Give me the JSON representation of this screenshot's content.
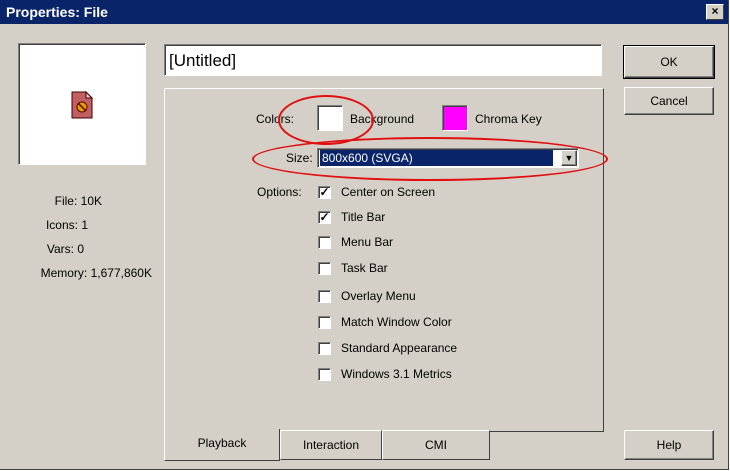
{
  "window": {
    "title": "Properties: File",
    "close_label": "×"
  },
  "left": {
    "file": "File: 10K",
    "icons": "Icons: 1",
    "vars": "Vars: 0",
    "memory": "Memory: 1,677,860K"
  },
  "name_field": {
    "value": "[Untitled]"
  },
  "colors": {
    "label": "Colors:",
    "background_label": "Background",
    "chroma_label": "Chroma Key",
    "background_color": "#ffffff",
    "chroma_color": "#ff00ff"
  },
  "size": {
    "label": "Size:",
    "value": "800x600 (SVGA)"
  },
  "options": {
    "label": "Options:",
    "items": [
      {
        "label": "Center on Screen",
        "checked": true
      },
      {
        "label": "Title Bar",
        "checked": true
      },
      {
        "label": "Menu Bar",
        "checked": false
      },
      {
        "label": "Task Bar",
        "checked": false
      },
      {
        "label": "Overlay Menu",
        "checked": false
      },
      {
        "label": "Match Window Color",
        "checked": false
      },
      {
        "label": "Standard Appearance",
        "checked": false
      },
      {
        "label": "Windows 3.1 Metrics",
        "checked": false
      }
    ]
  },
  "tabs": [
    "Playback",
    "Interaction",
    "CMI"
  ],
  "buttons": {
    "ok": "OK",
    "cancel": "Cancel",
    "help": "Help"
  }
}
